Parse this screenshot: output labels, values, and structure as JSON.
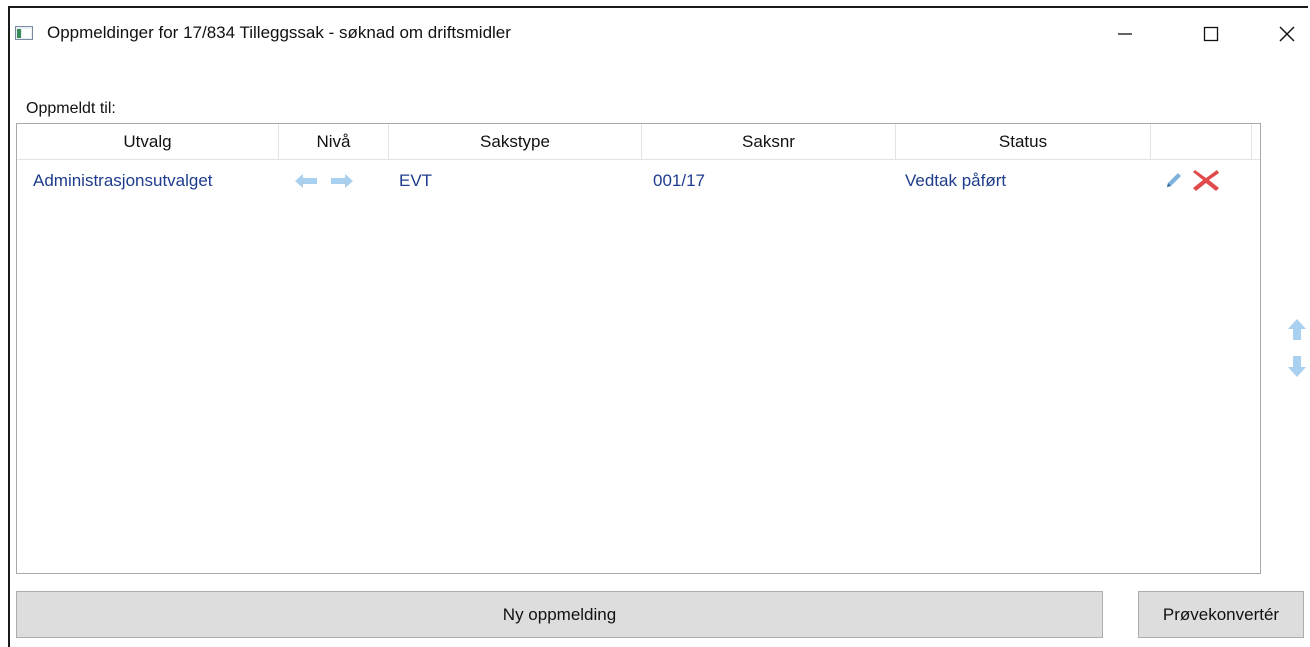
{
  "window": {
    "title": "Oppmeldinger for 17/834 Tilleggssak - søknad om driftsmidler"
  },
  "section_label": "Oppmeldt til:",
  "table": {
    "columns": [
      "Utvalg",
      "Nivå",
      "Sakstype",
      "Saksnr",
      "Status",
      ""
    ],
    "rows": [
      {
        "utvalg": "Administrasjonsutvalget",
        "niva_icons": [
          "arrow-left-icon",
          "arrow-right-icon"
        ],
        "sakstype": "EVT",
        "saksnr": "001/17",
        "status": "Vedtak påført",
        "action_icons": [
          "edit-pencil-icon",
          "delete-x-icon"
        ]
      }
    ]
  },
  "side_controls": [
    "move-up-icon",
    "move-down-icon"
  ],
  "buttons": {
    "new_label": "Ny oppmelding",
    "convert_label": "Prøvekonvertér"
  },
  "colors": {
    "link_text": "#1e3c8c",
    "arrow_icon": "#a9d0ef",
    "delete_icon": "#e04a4a",
    "button_bg": "#dddddd"
  }
}
